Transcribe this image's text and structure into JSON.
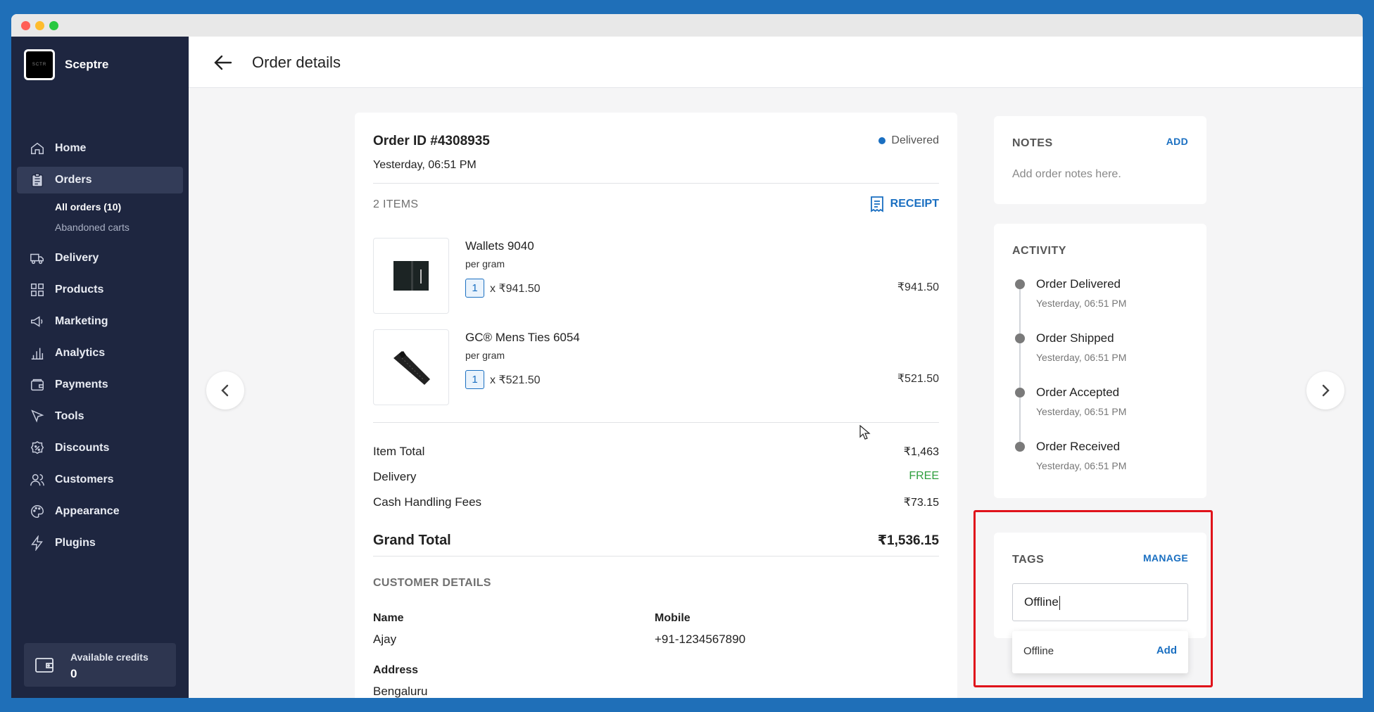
{
  "brand": {
    "name": "Sceptre",
    "logo_text": "SCTR"
  },
  "sidebar": {
    "items": [
      {
        "label": "Home",
        "icon": "home-icon"
      },
      {
        "label": "Orders",
        "icon": "clipboard-icon"
      },
      {
        "label": "Delivery",
        "icon": "truck-icon"
      },
      {
        "label": "Products",
        "icon": "grid-icon"
      },
      {
        "label": "Marketing",
        "icon": "megaphone-icon"
      },
      {
        "label": "Analytics",
        "icon": "bar-chart-icon"
      },
      {
        "label": "Payments",
        "icon": "wallet-icon"
      },
      {
        "label": "Tools",
        "icon": "pointer-icon"
      },
      {
        "label": "Discounts",
        "icon": "percent-badge-icon"
      },
      {
        "label": "Customers",
        "icon": "users-icon"
      },
      {
        "label": "Appearance",
        "icon": "palette-icon"
      },
      {
        "label": "Plugins",
        "icon": "lightning-icon"
      }
    ],
    "orders_sub": [
      "All orders (10)",
      "Abandoned carts"
    ],
    "credits": {
      "label": "Available credits",
      "value": "0"
    }
  },
  "header": {
    "title": "Order details"
  },
  "order": {
    "id": "Order ID #4308935",
    "date": "Yesterday, 06:51 PM",
    "status": "Delivered",
    "items_count": "2 ITEMS",
    "receipt_label": "RECEIPT",
    "items": [
      {
        "name": "Wallets 9040",
        "unit": "per gram",
        "qty": "1",
        "unit_price": "x ₹941.50",
        "total": "₹941.50"
      },
      {
        "name": "GC® Mens Ties 6054",
        "unit": "per gram",
        "qty": "1",
        "unit_price": "x ₹521.50",
        "total": "₹521.50"
      }
    ],
    "summary": {
      "item_total_label": "Item Total",
      "item_total": "₹1,463",
      "delivery_label": "Delivery",
      "delivery": "FREE",
      "fees_label": "Cash Handling Fees",
      "fees": "₹73.15",
      "grand_label": "Grand Total",
      "grand": "₹1,536.15"
    },
    "customer": {
      "heading": "CUSTOMER DETAILS",
      "name_label": "Name",
      "name": "Ajay",
      "mobile_label": "Mobile",
      "mobile": "+91-1234567890",
      "address_label": "Address",
      "address": "Bengaluru"
    }
  },
  "notes": {
    "heading": "NOTES",
    "action": "ADD",
    "placeholder": "Add order notes here."
  },
  "activity": {
    "heading": "ACTIVITY",
    "events": [
      {
        "title": "Order Delivered",
        "time": "Yesterday, 06:51 PM"
      },
      {
        "title": "Order Shipped",
        "time": "Yesterday, 06:51 PM"
      },
      {
        "title": "Order Accepted",
        "time": "Yesterday, 06:51 PM"
      },
      {
        "title": "Order Received",
        "time": "Yesterday, 06:51 PM"
      }
    ]
  },
  "tags": {
    "heading": "TAGS",
    "action": "MANAGE",
    "input_value": "Offline",
    "suggestion": "Offline",
    "suggestion_action": "Add"
  },
  "colors": {
    "sidebar": "#1e2640",
    "accent": "#1a6fc1",
    "highlight": "#e0131b",
    "free": "#2e9e3e"
  }
}
